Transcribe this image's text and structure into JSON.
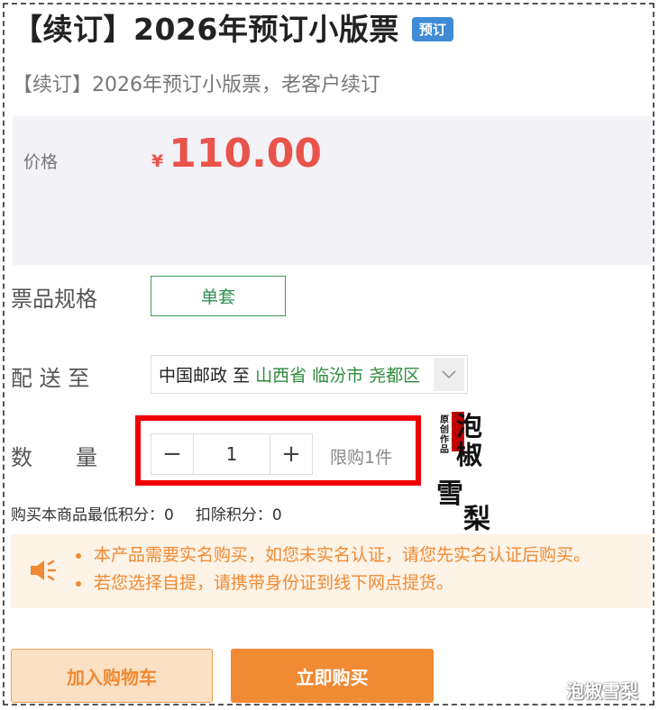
{
  "product": {
    "title": "【续订】2026年预订小版票",
    "badge": "预订",
    "subtitle": "【续订】2026年预订小版票，老客户续订"
  },
  "price": {
    "label": "价格",
    "currency_symbol": "¥",
    "value": "110.00",
    "color": "#e9534a"
  },
  "spec": {
    "label": "票品规格",
    "selected": "单套"
  },
  "shipping": {
    "label": "配 送 至",
    "carrier": "中国邮政 至",
    "region": "山西省 临汾市 尧都区",
    "caret_icon": "chevron-down-icon"
  },
  "quantity": {
    "label": "数　　量",
    "minus": "−",
    "value": "1",
    "plus": "+",
    "limit": "限购1件",
    "highlight_color": "#f00000"
  },
  "seal": {
    "small_text": "原创作品",
    "big_text": "泡椒",
    "line2": "雪",
    "line3": "梨"
  },
  "points": {
    "min_points": "购买本商品最低积分：0",
    "deduct_points": "扣除积分：0"
  },
  "notice": {
    "icon": "speaker-icon",
    "items": [
      "本产品需要实名购买，如您未实名认证，请您先实名认证后购买。",
      "若您选择自提，请携带身份证到线下网点提货。"
    ]
  },
  "actions": {
    "add_to_cart": "加入购物车",
    "buy_now": "立即购买",
    "accent": "#f08a33"
  },
  "watermark": "泡椒雪梨"
}
